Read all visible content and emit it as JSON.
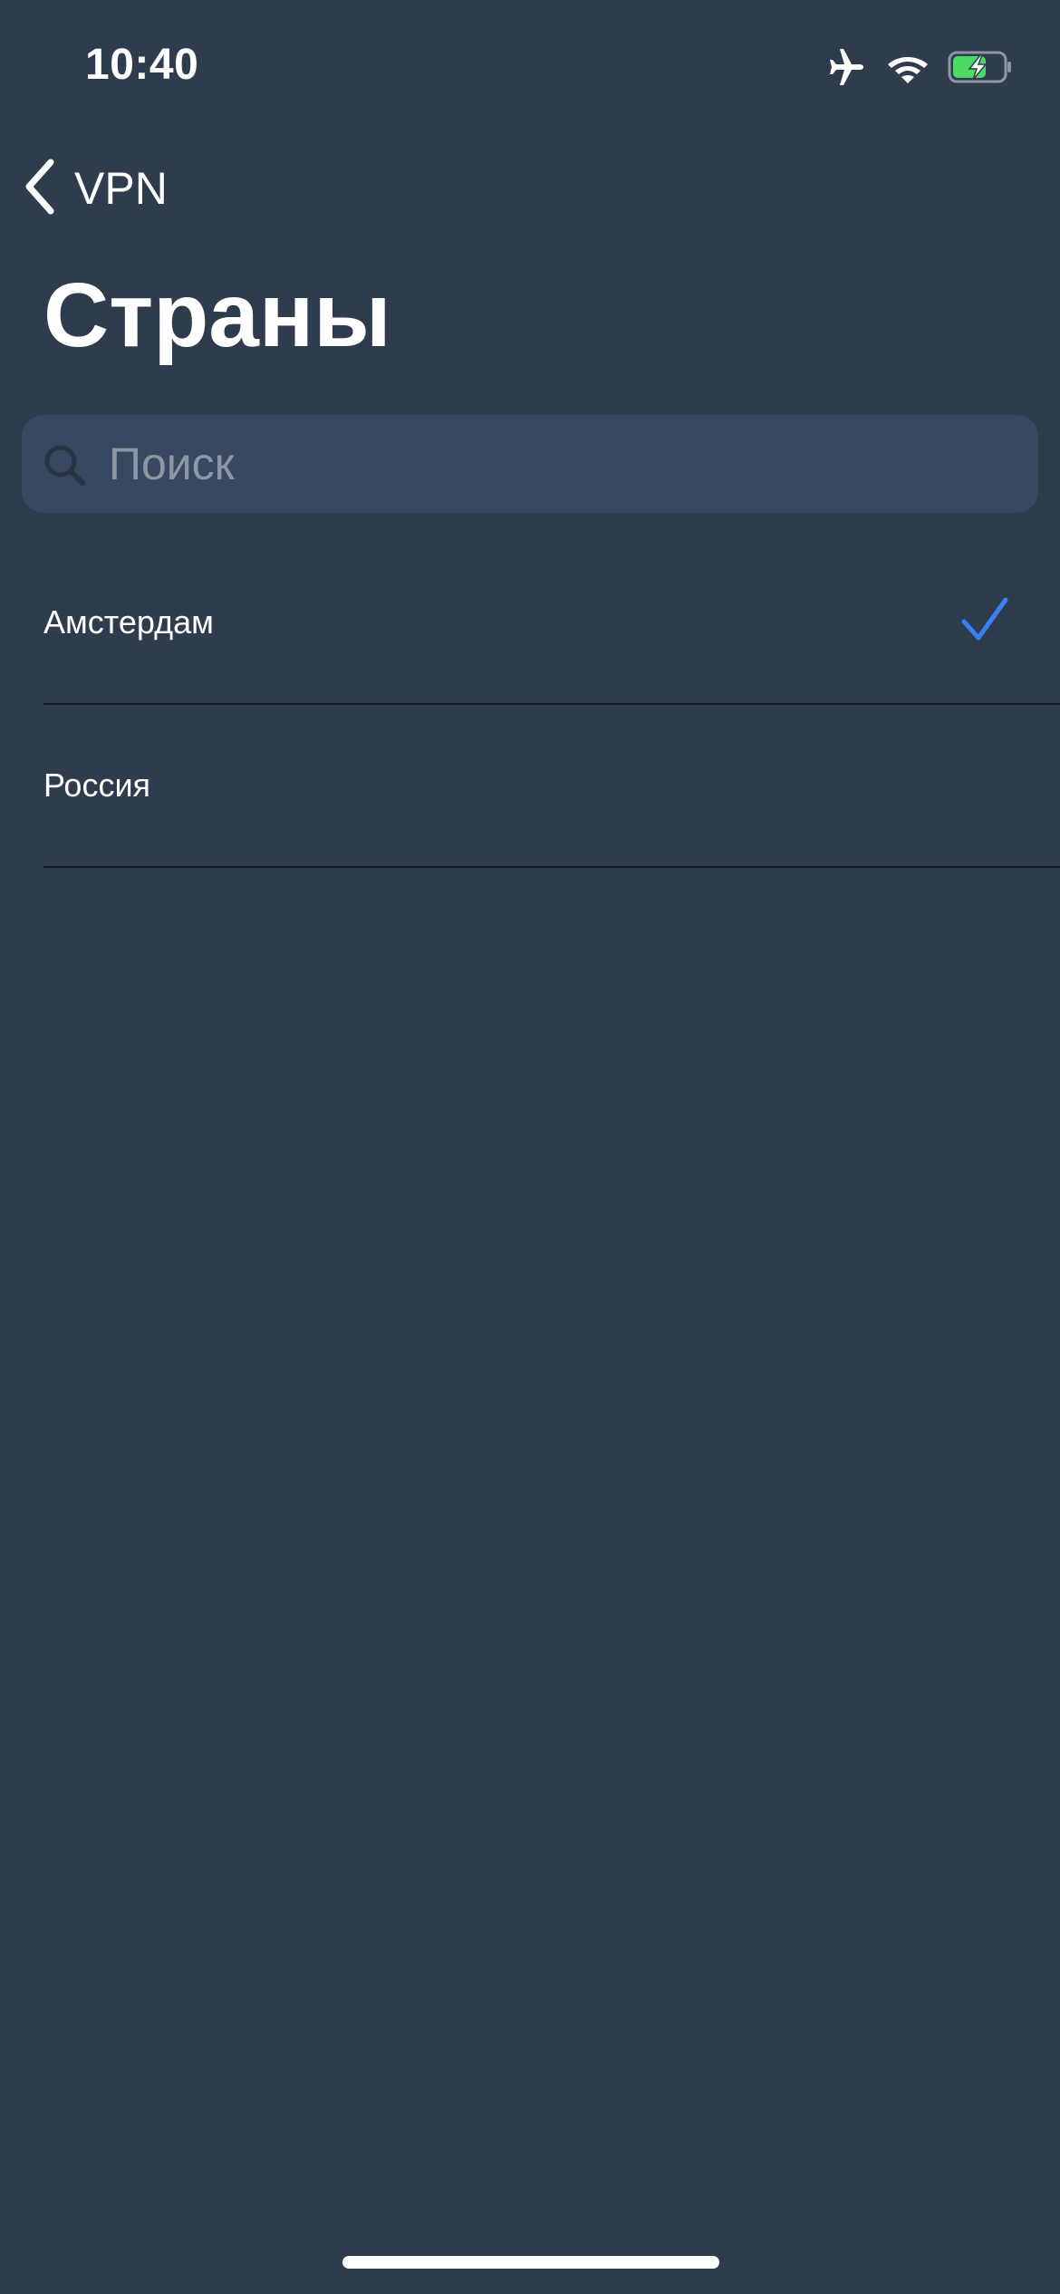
{
  "status_bar": {
    "time": "10:40",
    "icons": [
      "airplane-icon",
      "wifi-icon",
      "battery-charging-icon"
    ],
    "battery_color": "#4cd964"
  },
  "nav": {
    "back_label": "VPN"
  },
  "page": {
    "title": "Страны"
  },
  "search": {
    "placeholder": "Поиск",
    "value": ""
  },
  "countries": [
    {
      "label": "Амстердам",
      "selected": true
    },
    {
      "label": "Россия",
      "selected": false
    }
  ],
  "colors": {
    "background": "#2e3c4e",
    "search_background": "#374860",
    "accent": "#3a7ff6",
    "divider": "#14181f"
  }
}
